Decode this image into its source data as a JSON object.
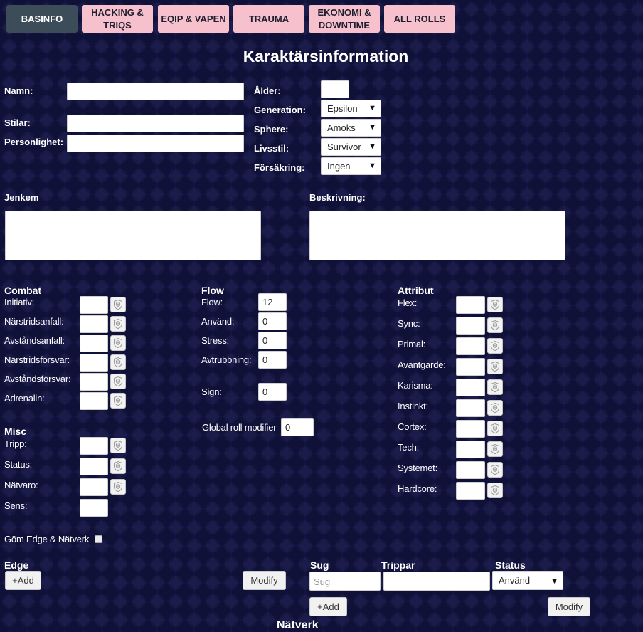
{
  "tabs": [
    {
      "label": "BASINFO"
    },
    {
      "label": "HACKING &\nTRIQS"
    },
    {
      "label": "EQIP & VAPEN"
    },
    {
      "label": "TRAUMA"
    },
    {
      "label": "EKONOMI &\nDOWNTIME"
    },
    {
      "label": "ALL ROLLS"
    }
  ],
  "page_title": "Karaktärsinformation",
  "basic": {
    "namn_label": "Namn:",
    "stilar_label": "Stilar:",
    "personlighet_label": "Personlighet:",
    "alder_label": "Ålder:",
    "generation_label": "Generation:",
    "generation_value": "Epsilon",
    "sphere_label": "Sphere:",
    "sphere_value": "Amoks",
    "livsstil_label": "Livsstil:",
    "livsstil_value": "Survivor",
    "forsakring_label": "Försäkring:",
    "forsakring_value": "Ingen"
  },
  "jenkem_label": "Jenkem",
  "beskrivning_label": "Beskrivning:",
  "combat": {
    "title": "Combat",
    "rows": [
      {
        "label": "Initiativ:"
      },
      {
        "label": "Närstridsanfall:"
      },
      {
        "label": "Avståndsanfall:"
      },
      {
        "label": "Närstridsförsvar:"
      },
      {
        "label": "Avståndsförsvar:"
      },
      {
        "label": "Adrenalin:"
      }
    ]
  },
  "misc": {
    "title": "Misc",
    "rows": [
      {
        "label": "Tripp:"
      },
      {
        "label": "Status:"
      },
      {
        "label": "Nätvaro:"
      },
      {
        "label": "Sens:"
      }
    ]
  },
  "flow": {
    "title": "Flow",
    "rows": [
      {
        "label": "Flow:",
        "value": "12"
      },
      {
        "label": "Använd:",
        "value": "0"
      },
      {
        "label": "Stress:",
        "value": "0"
      },
      {
        "label": "Avtrubbning:",
        "value": "0"
      },
      {
        "label": "Sign:",
        "value": "0"
      }
    ],
    "global_label": "Global roll modifier",
    "global_value": "0"
  },
  "attribut": {
    "title": "Attribut",
    "rows": [
      {
        "label": "Flex:"
      },
      {
        "label": "Sync:"
      },
      {
        "label": "Primal:"
      },
      {
        "label": "Avantgarde:"
      },
      {
        "label": "Karisma:"
      },
      {
        "label": "Instinkt:"
      },
      {
        "label": "Cortex:"
      },
      {
        "label": "Tech:"
      },
      {
        "label": "Systemet:"
      },
      {
        "label": "Hardcore:"
      }
    ]
  },
  "gom_label": "Göm Edge & Nätverk",
  "edge": {
    "title": "Edge",
    "add_label": "+Add",
    "modify_label": "Modify"
  },
  "sug": {
    "sug_header": "Sug",
    "trippar_header": "Trippar",
    "status_header": "Status",
    "sug_placeholder": "Sug",
    "status_value": "Använd",
    "add_label": "+Add",
    "modify_label": "Modify"
  },
  "natverk_title": "Nätverk",
  "colors": {
    "background": "#141546",
    "tab": "#f6c0cc",
    "tab_active": "#3c4c58"
  },
  "icons": {
    "roll": "dice-shield-icon",
    "dropdown": "caret-down-icon"
  }
}
